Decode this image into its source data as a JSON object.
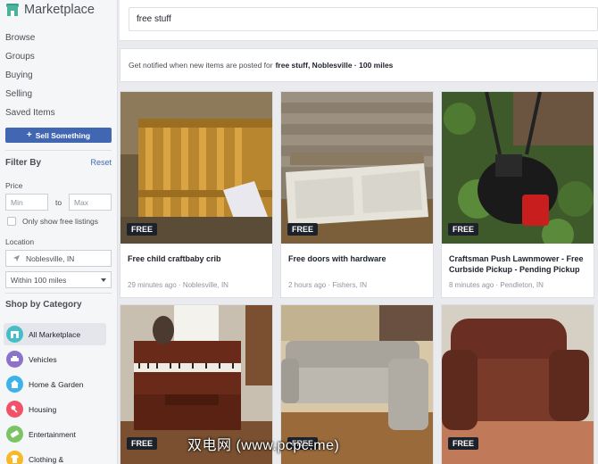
{
  "sidebar": {
    "title": "Marketplace",
    "nav": [
      "Browse",
      "Groups",
      "Buying",
      "Selling",
      "Saved Items"
    ],
    "sell_button": "Sell Something",
    "filter_heading": "Filter By",
    "reset": "Reset",
    "price_label": "Price",
    "price_min_placeholder": "Min",
    "price_to": "to",
    "price_max_placeholder": "Max",
    "free_only_label": "Only show free listings",
    "location_label": "Location",
    "location_value": "Noblesville, IN",
    "radius_value": "Within 100 miles",
    "category_heading": "Shop by Category",
    "categories": [
      {
        "label": "All Marketplace",
        "color": "#44bec7"
      },
      {
        "label": "Vehicles",
        "color": "#8c72cb"
      },
      {
        "label": "Home & Garden",
        "color": "#3cb3e8"
      },
      {
        "label": "Housing",
        "color": "#f25268"
      },
      {
        "label": "Entertainment",
        "color": "#7bc464"
      },
      {
        "label": "Clothing &",
        "color": "#f7b928"
      }
    ]
  },
  "search": {
    "value": "free stuff"
  },
  "notify": {
    "text": "Get notified when new items are posted for",
    "query": "free stuff, Noblesville · 100 miles"
  },
  "listings": [
    {
      "price": "FREE",
      "title": "Free child craftbaby crib",
      "meta": "29 minutes ago · Noblesville, IN"
    },
    {
      "price": "FREE",
      "title": "Free doors with hardware",
      "meta": "2 hours ago · Fishers, IN"
    },
    {
      "price": "FREE",
      "title": "Craftsman Push Lawnmower - Free Curbside Pickup - Pending Pickup",
      "meta": "8 minutes ago · Pendleton, IN"
    },
    {
      "price": "FREE",
      "title": "",
      "meta": ""
    },
    {
      "price": "FREE",
      "title": "",
      "meta": ""
    },
    {
      "price": "FREE",
      "title": "",
      "meta": ""
    }
  ],
  "watermark": "双电网 (www.pcpc.me)",
  "colors": {
    "accent": "#4267b2",
    "badge": "#1d2129"
  }
}
